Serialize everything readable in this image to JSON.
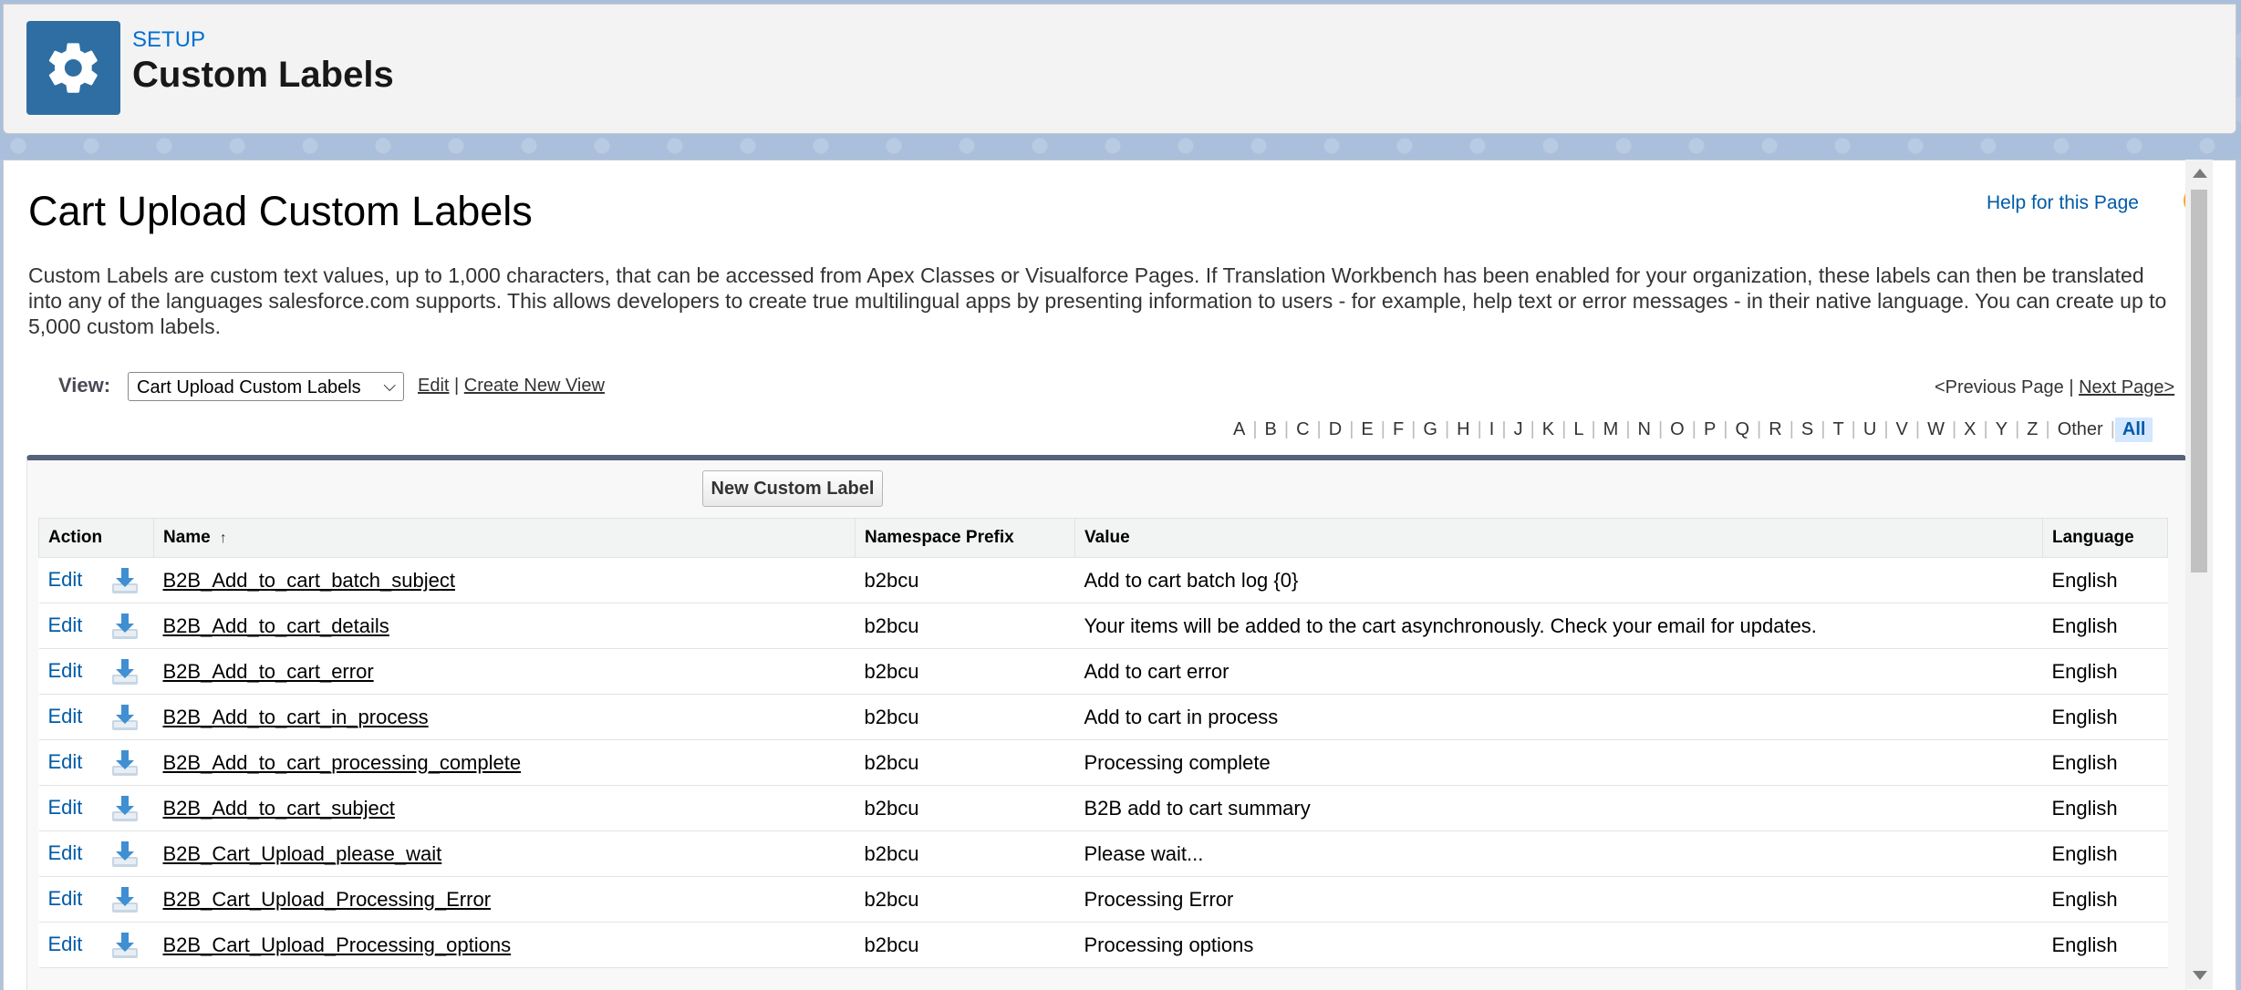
{
  "header": {
    "setup_label": "SETUP",
    "title": "Custom Labels",
    "icon": "gear-icon"
  },
  "page": {
    "title": "Cart Upload Custom Labels",
    "help_link": "Help for this Page",
    "help_icon": "?",
    "description": "Custom Labels are custom text values, up to 1,000 characters, that can be accessed from Apex Classes or Visualforce Pages. If Translation Workbench has been enabled for your organization, these labels can then be translated into any of the languages salesforce.com supports. This allows developers to create true multilingual apps by presenting information to users - for example, help text or error messages - in their native language. You can create up to 5,000 custom labels."
  },
  "view": {
    "label": "View:",
    "selected": "Cart Upload Custom Labels",
    "edit_link": "Edit",
    "separator": "|",
    "create_link": "Create New View"
  },
  "pager": {
    "prev": "<Previous Page",
    "separator": "|",
    "next": "Next Page>"
  },
  "alphabet": [
    "A",
    "B",
    "C",
    "D",
    "E",
    "F",
    "G",
    "H",
    "I",
    "J",
    "K",
    "L",
    "M",
    "N",
    "O",
    "P",
    "Q",
    "R",
    "S",
    "T",
    "U",
    "V",
    "W",
    "X",
    "Y",
    "Z",
    "Other",
    "All"
  ],
  "alphabet_selected": "All",
  "list": {
    "new_button": "New Custom Label",
    "columns": {
      "action": "Action",
      "name": "Name",
      "sort_indicator": "↑",
      "namespace": "Namespace Prefix",
      "value": "Value",
      "language": "Language"
    },
    "rows": [
      {
        "action": "Edit",
        "name": "B2B_Add_to_cart_batch_subject",
        "namespace": "b2bcu",
        "value": "Add to cart batch log {0}",
        "language": "English"
      },
      {
        "action": "Edit",
        "name": "B2B_Add_to_cart_details",
        "namespace": "b2bcu",
        "value": "Your items will be added to the cart asynchronously. Check your email for updates.",
        "language": "English"
      },
      {
        "action": "Edit",
        "name": "B2B_Add_to_cart_error",
        "namespace": "b2bcu",
        "value": "Add to cart error",
        "language": "English"
      },
      {
        "action": "Edit",
        "name": "B2B_Add_to_cart_in_process",
        "namespace": "b2bcu",
        "value": "Add to cart in process",
        "language": "English"
      },
      {
        "action": "Edit",
        "name": "B2B_Add_to_cart_processing_complete",
        "namespace": "b2bcu",
        "value": "Processing complete",
        "language": "English"
      },
      {
        "action": "Edit",
        "name": "B2B_Add_to_cart_subject",
        "namespace": "b2bcu",
        "value": "B2B add to cart summary",
        "language": "English"
      },
      {
        "action": "Edit",
        "name": "B2B_Cart_Upload_please_wait",
        "namespace": "b2bcu",
        "value": "Please wait...",
        "language": "English"
      },
      {
        "action": "Edit",
        "name": "B2B_Cart_Upload_Processing_Error",
        "namespace": "b2bcu",
        "value": "Processing Error",
        "language": "English"
      },
      {
        "action": "Edit",
        "name": "B2B_Cart_Upload_Processing_options",
        "namespace": "b2bcu",
        "value": "Processing options",
        "language": "English"
      }
    ]
  },
  "colors": {
    "link_blue": "#015ba7",
    "setup_blue": "#0070d2",
    "icon_bg": "#2e6ea2",
    "help_orange": "#f5a623"
  }
}
